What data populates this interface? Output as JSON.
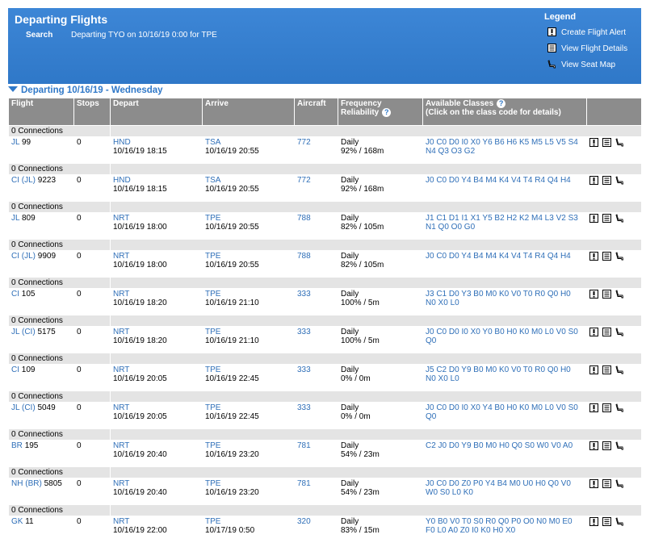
{
  "header": {
    "title": "Departing Flights",
    "search_label": "Search",
    "search_value": "Departing TYO on 10/16/19 0:00 for TPE"
  },
  "legend": {
    "title": "Legend",
    "items": [
      {
        "icon": "alert-icon",
        "label": "Create Flight Alert"
      },
      {
        "icon": "details-icon",
        "label": "View Flight Details"
      },
      {
        "icon": "seat-icon",
        "label": "View Seat Map"
      }
    ]
  },
  "section": {
    "label": "Departing 10/16/19 - Wednesday"
  },
  "table": {
    "headers": {
      "flight": "Flight",
      "stops": "Stops",
      "depart": "Depart",
      "arrive": "Arrive",
      "aircraft": "Aircraft",
      "frequency": "Frequency",
      "reliability": "Reliability",
      "classes": "Available Classes",
      "classes_note": "(Click on the class code for details)"
    },
    "connection_label": "0 Connections",
    "rows": [
      {
        "flight_code": "JL",
        "flight_op": "",
        "flight_num": "99",
        "stops": "0",
        "dep_airport": "HND",
        "dep_time": "10/16/19 18:15",
        "arr_airport": "TSA",
        "arr_time": "10/16/19 20:55",
        "aircraft": "772",
        "frequency": "Daily",
        "reliability": "92% / 168m",
        "classes_1": "J0 C0 D0 I0 X0 Y6 B6 H6 K5 M5 L5 V5 S4",
        "classes_2": "N4 Q3 O3 G2"
      },
      {
        "flight_code": "CI",
        "flight_op": "(JL)",
        "flight_num": "9223",
        "stops": "0",
        "dep_airport": "HND",
        "dep_time": "10/16/19 18:15",
        "arr_airport": "TSA",
        "arr_time": "10/16/19 20:55",
        "aircraft": "772",
        "frequency": "Daily",
        "reliability": "92% / 168m",
        "classes_1": "J0 C0 D0 Y4 B4 M4 K4 V4 T4 R4 Q4 H4",
        "classes_2": ""
      },
      {
        "flight_code": "JL",
        "flight_op": "",
        "flight_num": "809",
        "stops": "0",
        "dep_airport": "NRT",
        "dep_time": "10/16/19 18:00",
        "arr_airport": "TPE",
        "arr_time": "10/16/19 20:55",
        "aircraft": "788",
        "frequency": "Daily",
        "reliability": "82% / 105m",
        "classes_1": "J1 C1 D1 I1 X1 Y5 B2 H2 K2 M4 L3 V2 S3",
        "classes_2": "N1 Q0 O0 G0"
      },
      {
        "flight_code": "CI",
        "flight_op": "(JL)",
        "flight_num": "9909",
        "stops": "0",
        "dep_airport": "NRT",
        "dep_time": "10/16/19 18:00",
        "arr_airport": "TPE",
        "arr_time": "10/16/19 20:55",
        "aircraft": "788",
        "frequency": "Daily",
        "reliability": "82% / 105m",
        "classes_1": "J0 C0 D0 Y4 B4 M4 K4 V4 T4 R4 Q4 H4",
        "classes_2": ""
      },
      {
        "flight_code": "CI",
        "flight_op": "",
        "flight_num": "105",
        "stops": "0",
        "dep_airport": "NRT",
        "dep_time": "10/16/19 18:20",
        "arr_airport": "TPE",
        "arr_time": "10/16/19 21:10",
        "aircraft": "333",
        "frequency": "Daily",
        "reliability": "100% / 5m",
        "classes_1": "J3 C1 D0 Y3 B0 M0 K0 V0 T0 R0 Q0 H0",
        "classes_2": "N0 X0 L0"
      },
      {
        "flight_code": "JL",
        "flight_op": "(CI)",
        "flight_num": "5175",
        "stops": "0",
        "dep_airport": "NRT",
        "dep_time": "10/16/19 18:20",
        "arr_airport": "TPE",
        "arr_time": "10/16/19 21:10",
        "aircraft": "333",
        "frequency": "Daily",
        "reliability": "100% / 5m",
        "classes_1": "J0 C0 D0 I0 X0 Y0 B0 H0 K0 M0 L0 V0 S0",
        "classes_2": "Q0"
      },
      {
        "flight_code": "CI",
        "flight_op": "",
        "flight_num": "109",
        "stops": "0",
        "dep_airport": "NRT",
        "dep_time": "10/16/19 20:05",
        "arr_airport": "TPE",
        "arr_time": "10/16/19 22:45",
        "aircraft": "333",
        "frequency": "Daily",
        "reliability": "0% / 0m",
        "classes_1": "J5 C2 D0 Y9 B0 M0 K0 V0 T0 R0 Q0 H0",
        "classes_2": "N0 X0 L0"
      },
      {
        "flight_code": "JL",
        "flight_op": "(CI)",
        "flight_num": "5049",
        "stops": "0",
        "dep_airport": "NRT",
        "dep_time": "10/16/19 20:05",
        "arr_airport": "TPE",
        "arr_time": "10/16/19 22:45",
        "aircraft": "333",
        "frequency": "Daily",
        "reliability": "0% / 0m",
        "classes_1": "J0 C0 D0 I0 X0 Y4 B0 H0 K0 M0 L0 V0 S0",
        "classes_2": "Q0"
      },
      {
        "flight_code": "BR",
        "flight_op": "",
        "flight_num": "195",
        "stops": "0",
        "dep_airport": "NRT",
        "dep_time": "10/16/19 20:40",
        "arr_airport": "TPE",
        "arr_time": "10/16/19 23:20",
        "aircraft": "781",
        "frequency": "Daily",
        "reliability": "54% / 23m",
        "classes_1": "C2 J0 D0 Y9 B0 M0 H0 Q0 S0 W0 V0 A0",
        "classes_2": ""
      },
      {
        "flight_code": "NH",
        "flight_op": "(BR)",
        "flight_num": "5805",
        "stops": "0",
        "dep_airport": "NRT",
        "dep_time": "10/16/19 20:40",
        "arr_airport": "TPE",
        "arr_time": "10/16/19 23:20",
        "aircraft": "781",
        "frequency": "Daily",
        "reliability": "54% / 23m",
        "classes_1": "J0 C0 D0 Z0 P0 Y4 B4 M0 U0 H0 Q0 V0",
        "classes_2": "W0 S0 L0 K0"
      },
      {
        "flight_code": "GK",
        "flight_op": "",
        "flight_num": "11",
        "stops": "0",
        "dep_airport": "NRT",
        "dep_time": "10/16/19 22:00",
        "arr_airport": "TPE",
        "arr_time": "10/17/19 0:50",
        "aircraft": "320",
        "frequency": "Daily",
        "reliability": "83% / 15m",
        "classes_1": "Y0 B0 V0 T0 S0 R0 Q0 P0 O0 N0 M0 E0",
        "classes_2": "F0 L0 A0 Z0 I0 K0 H0 X0"
      }
    ]
  }
}
